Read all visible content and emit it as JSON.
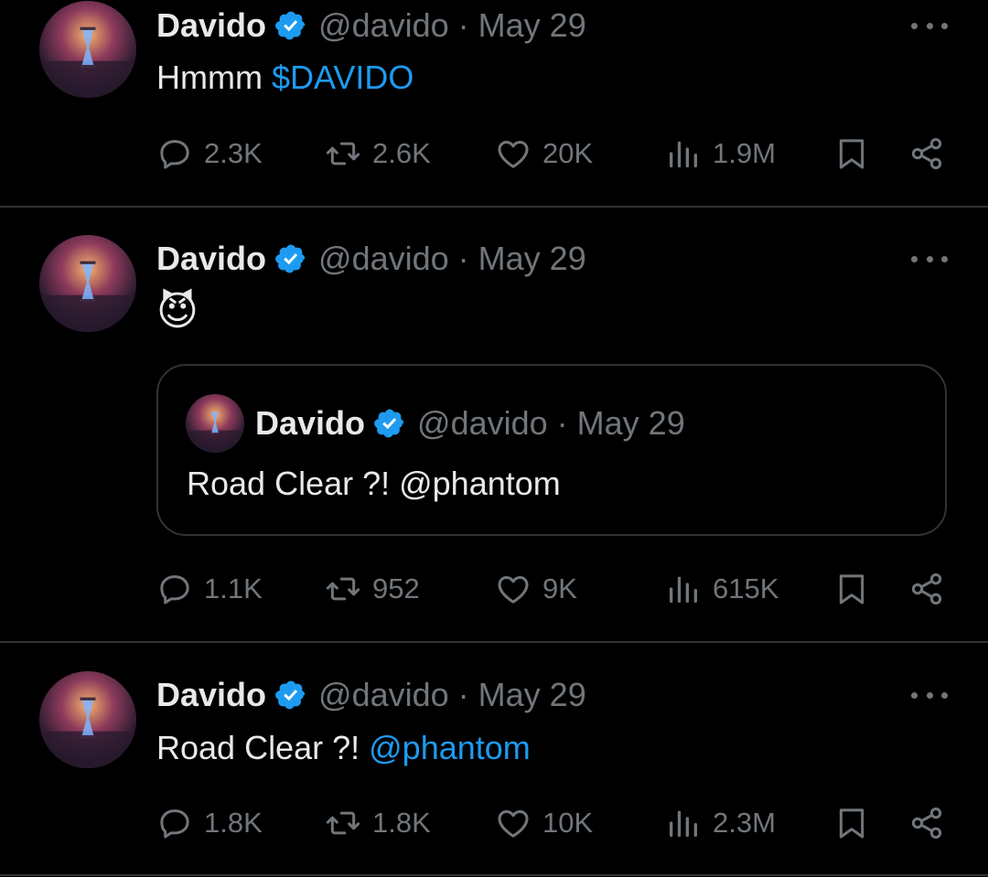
{
  "tweets": [
    {
      "name": "Davido",
      "handle": "@davido",
      "separator": "·",
      "date": "May 29",
      "text": "Hmmm ",
      "link": "$DAVIDO",
      "replies": "2.3K",
      "reposts": "2.6K",
      "likes": "20K",
      "views": "1.9M"
    },
    {
      "name": "Davido",
      "handle": "@davido",
      "separator": "·",
      "date": "May 29",
      "emoji": "😈",
      "quote": {
        "name": "Davido",
        "handle": "@davido",
        "separator": "·",
        "date": "May 29",
        "text": "Road Clear ?! @phantom"
      },
      "replies": "1.1K",
      "reposts": "952",
      "likes": "9K",
      "views": "615K"
    },
    {
      "name": "Davido",
      "handle": "@davido",
      "separator": "·",
      "date": "May 29",
      "text": "Road Clear ?! ",
      "link": "@phantom",
      "replies": "1.8K",
      "reposts": "1.8K",
      "likes": "10K",
      "views": "2.3M"
    }
  ],
  "colors": {
    "background": "#000000",
    "text": "#e7e9ea",
    "muted": "#71767b",
    "link": "#1d9bf0",
    "verified": "#1d9bf0",
    "border": "#2f3336"
  },
  "icons": [
    "reply-icon",
    "repost-icon",
    "like-icon",
    "views-icon",
    "bookmark-icon",
    "share-icon",
    "more-icon",
    "verified-badge-icon"
  ]
}
